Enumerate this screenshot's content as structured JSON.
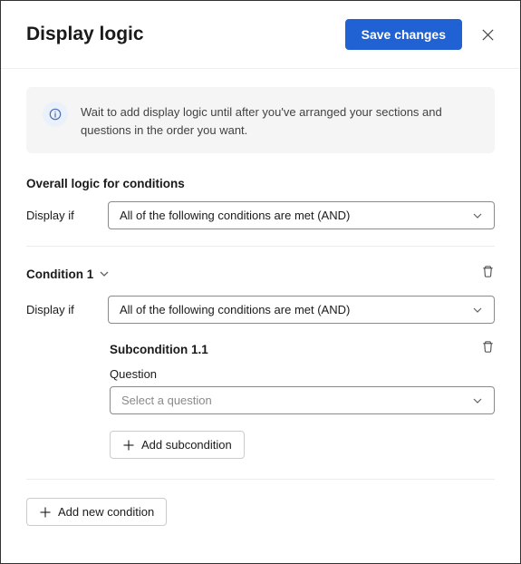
{
  "header": {
    "title": "Display logic",
    "save_label": "Save changes"
  },
  "info": {
    "text": "Wait to add display logic until after you've arranged your sections and questions in the order you want."
  },
  "overall": {
    "label": "Overall logic for conditions",
    "display_if_label": "Display if",
    "select_value": "All of the following conditions are met (AND)"
  },
  "condition": {
    "title": "Condition 1",
    "display_if_label": "Display if",
    "select_value": "All of the following conditions are met (AND)",
    "sub": {
      "title": "Subcondition 1.1",
      "question_label": "Question",
      "question_placeholder": "Select a question",
      "add_sub_label": "Add subcondition"
    }
  },
  "footer": {
    "add_condition_label": "Add new condition"
  }
}
